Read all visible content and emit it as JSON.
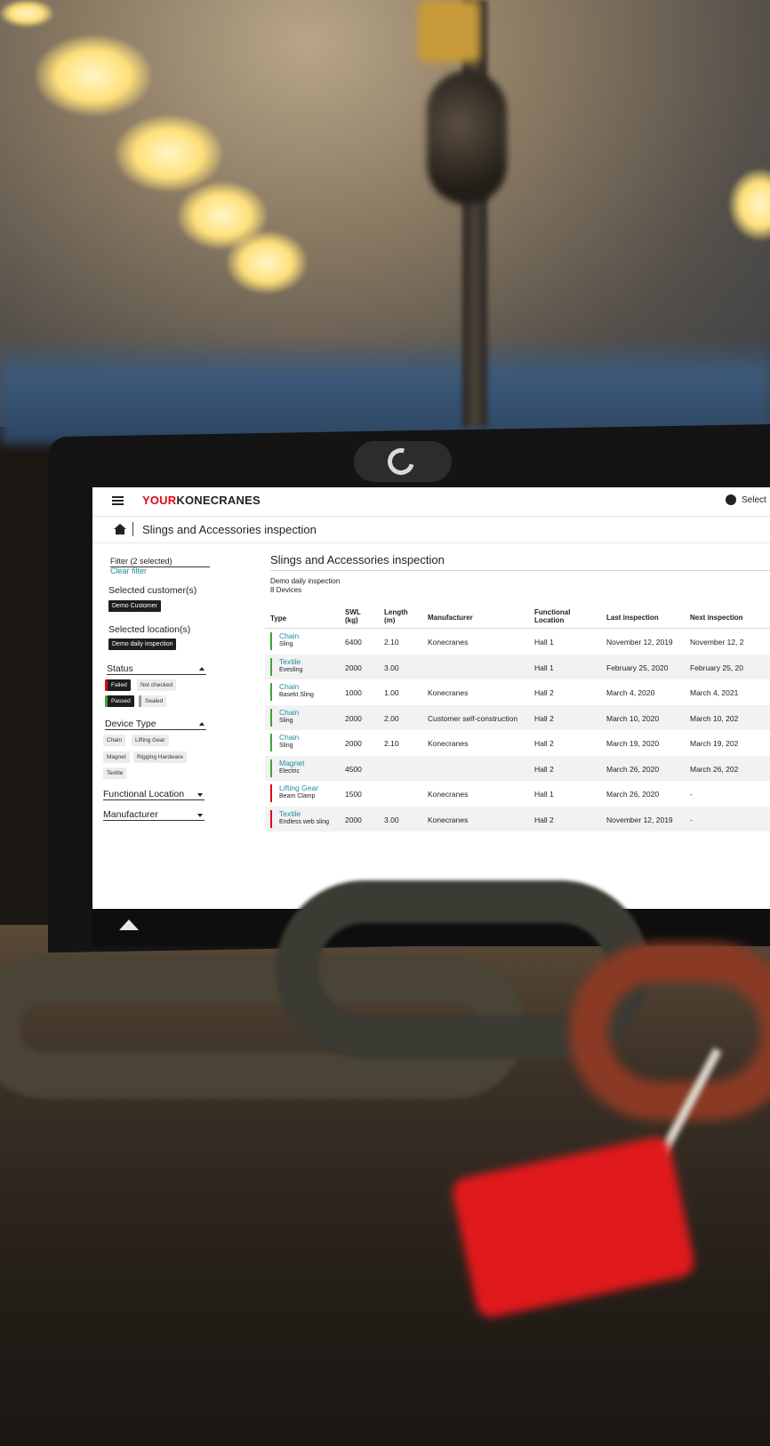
{
  "app": {
    "brand_your": "YOUR",
    "brand_name": "KONECRANES",
    "language_label": "Select",
    "breadcrumb_title": "Slings and Accessories inspection"
  },
  "sidebar": {
    "filter_title": "Filter (2 selected)",
    "clear_filter": "Clear filter",
    "customer_heading": "Selected customer(s)",
    "customer_chip": "Demo Customer",
    "location_heading": "Selected location(s)",
    "location_chip": "Demo daily inspection",
    "status_heading": "Status",
    "status_chips": [
      "Failed",
      "Not checked",
      "Passed",
      "Sealed"
    ],
    "device_type_heading": "Device Type",
    "device_type_chips": [
      "Chain",
      "Lifting Gear",
      "Magnet",
      "Rigging Hardware",
      "Textile"
    ],
    "functional_location_heading": "Functional Location",
    "manufacturer_heading": "Manufacturer"
  },
  "main": {
    "title": "Slings and Accessories inspection",
    "subtitle": "Demo daily inspection",
    "device_count": "8 Devices",
    "columns": {
      "type": "Type",
      "swl_1": "SWL",
      "swl_2": "(kg)",
      "length_1": "Length",
      "length_2": "(m)",
      "manufacturer": "Manufacturer",
      "functional_1": "Functional",
      "functional_2": "Location",
      "last_inspection": "Last inspection",
      "next_inspection": "Next inspection"
    },
    "rows": [
      {
        "type": "Chain",
        "subtype": "Sling",
        "swl": "6400",
        "length": "2.10",
        "manufacturer": "Konecranes",
        "location": "Hall 1",
        "last": "November 12, 2019",
        "next": "November 12, 2",
        "status_color": "#3da535"
      },
      {
        "type": "Textile",
        "subtype": "Evesling",
        "swl": "2000",
        "length": "3.00",
        "manufacturer": "",
        "location": "Hall 1",
        "last": "February 25, 2020",
        "next": "February 25, 20",
        "status_color": "#3da535"
      },
      {
        "type": "Chain",
        "subtype": "Basekt Sling",
        "swl": "1000",
        "length": "1.00",
        "manufacturer": "Konecranes",
        "location": "Hall 2",
        "last": "March 4, 2020",
        "next": "March 4, 2021",
        "status_color": "#3da535"
      },
      {
        "type": "Chain",
        "subtype": "Sling",
        "swl": "2000",
        "length": "2.00",
        "manufacturer": "Customer self-construction",
        "location": "Hall 2",
        "last": "March 10, 2020",
        "next": "March 10, 202",
        "status_color": "#3da535"
      },
      {
        "type": "Chain",
        "subtype": "Sling",
        "swl": "2000",
        "length": "2.10",
        "manufacturer": "Konecranes",
        "location": "Hall 2",
        "last": "March 19, 2020",
        "next": "March 19, 202",
        "status_color": "#3da535"
      },
      {
        "type": "Magnet",
        "subtype": "Electric",
        "swl": "4500",
        "length": "",
        "manufacturer": "",
        "location": "Hall 2",
        "last": "March 26, 2020",
        "next": "March 26, 202",
        "status_color": "#3da535"
      },
      {
        "type": "Lifting Gear",
        "subtype": "Beam Clamp",
        "swl": "1500",
        "length": "",
        "manufacturer": "Konecranes",
        "location": "Hall 1",
        "last": "March 26, 2020",
        "next": "-",
        "status_color": "#e30613"
      },
      {
        "type": "Textile",
        "subtype": "Endless web sling",
        "swl": "2000",
        "length": "3.00",
        "manufacturer": "Konecranes",
        "location": "Hall 2",
        "last": "November 12, 2019",
        "next": "-",
        "status_color": "#e30613"
      }
    ]
  },
  "colors": {
    "brand_red": "#e30613",
    "link_teal": "#1e8ba0",
    "passed_green": "#3da535"
  }
}
